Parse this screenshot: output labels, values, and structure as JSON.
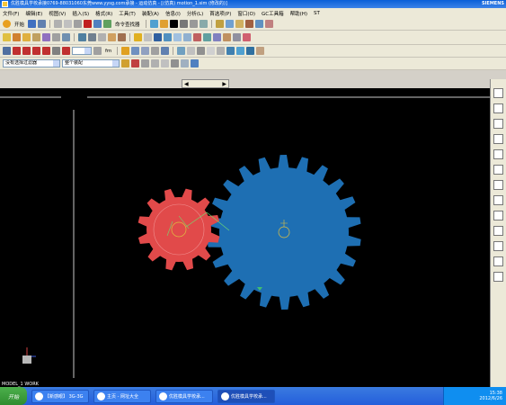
{
  "window": {
    "title": "优胜模具学校承接0769-88031060东莞www.yysg.com承接 - 运动仿真 - [(仿真) motion_1.sim (修改的)]",
    "brand": "SIEMENS"
  },
  "menu": [
    "文件(F)",
    "编辑(E)",
    "视图(V)",
    "插入(S)",
    "格式(R)",
    "工具(T)",
    "装配(A)",
    "信息(I)",
    "分析(L)",
    "首选项(P)",
    "窗口(O)",
    "GC工具箱",
    "帮助(H)",
    "ST"
  ],
  "toolbar": {
    "start_label": "开始",
    "cmd_finder_label": "命令查找器",
    "fit_label": "fm"
  },
  "selection": {
    "filter_value": "没有选择过滤器",
    "scope_value": "整个装配"
  },
  "viewport": {
    "work_part": "MODEL_1 WORK",
    "background": "#000000",
    "gear_small_color": "#e14a4a",
    "gear_large_color": "#1e6fb3"
  },
  "taskbar": {
    "start": "开始",
    "tasks": [
      "【新感眼】 3G-3G",
      "主页 - 网址大全",
      "优胜模具学校承...",
      "优胜模具学校承..."
    ],
    "clock": "15:38",
    "date": "2012/6/26"
  }
}
